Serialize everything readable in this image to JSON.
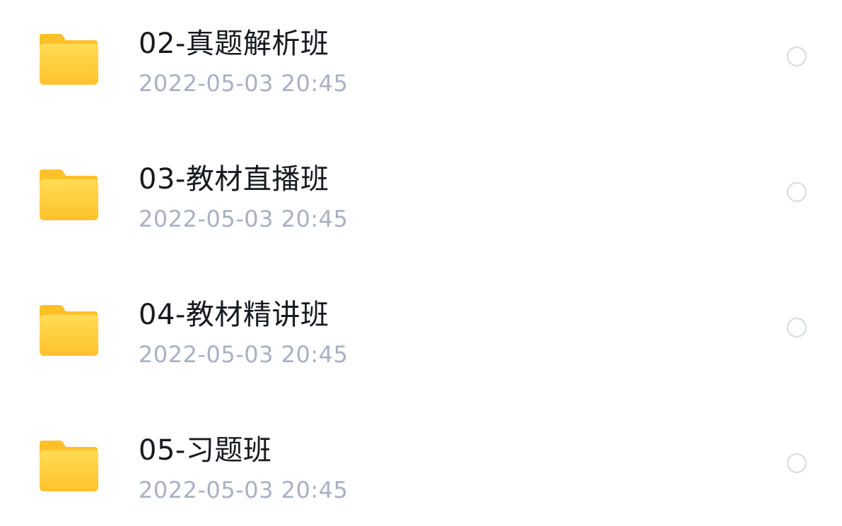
{
  "files": [
    {
      "name": "02-真题解析班",
      "date": "2022-05-03 20:45",
      "icon": "folder-icon",
      "selected": false
    },
    {
      "name": "03-教材直播班",
      "date": "2022-05-03 20:45",
      "icon": "folder-icon",
      "selected": false
    },
    {
      "name": "04-教材精讲班",
      "date": "2022-05-03 20:45",
      "icon": "folder-icon",
      "selected": false
    },
    {
      "name": "05-习题班",
      "date": "2022-05-03 20:45",
      "icon": "folder-icon",
      "selected": false
    }
  ],
  "colors": {
    "folder_top": "#FFD84A",
    "folder_bottom": "#FFC52C",
    "folder_tab": "#FFC12A",
    "title_text": "#17191F",
    "date_text": "#A9B0C2",
    "radio_border": "#D6D9E3"
  }
}
